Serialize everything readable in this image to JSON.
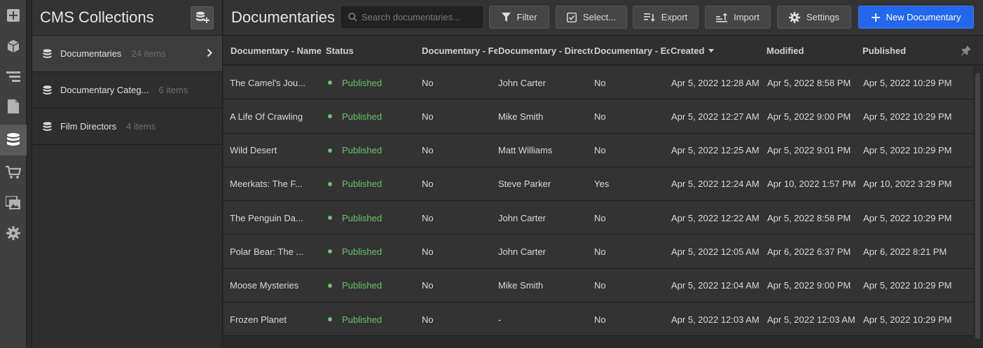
{
  "rail": {
    "items": [
      {
        "icon": "add-box-icon"
      },
      {
        "icon": "cube-icon"
      },
      {
        "icon": "navigator-icon"
      },
      {
        "icon": "pages-icon"
      },
      {
        "icon": "cms-icon",
        "active": true
      },
      {
        "icon": "ecommerce-icon"
      },
      {
        "icon": "assets-icon"
      },
      {
        "icon": "settings-icon"
      }
    ]
  },
  "panel": {
    "title": "CMS Collections",
    "collections": [
      {
        "name": "Documentaries",
        "count": "24 items",
        "active": true
      },
      {
        "name": "Documentary Categ...",
        "count": "6 items"
      },
      {
        "name": "Film Directors",
        "count": "4 items"
      }
    ]
  },
  "main": {
    "title": "Documentaries",
    "search_placeholder": "Search documentaries...",
    "buttons": {
      "filter": "Filter",
      "select": "Select...",
      "export": "Export",
      "import": "Import",
      "settings": "Settings",
      "new": "New Documentary"
    }
  },
  "table": {
    "headers": [
      "Documentary - Name",
      "Status",
      "Documentary - Featured",
      "Documentary - Director",
      "Documentary - Editor's Pick",
      "Created",
      "Modified",
      "Published"
    ],
    "rows": [
      {
        "name": "The Camel's Jou...",
        "status": "Published",
        "c3": "No",
        "director": "John Carter",
        "c5": "No",
        "created": "Apr 5, 2022 12:28 AM",
        "modified": "Apr 5, 2022 8:58 PM",
        "published": "Apr 5, 2022 10:29 PM"
      },
      {
        "name": "A Life Of Crawling",
        "status": "Published",
        "c3": "No",
        "director": "Mike Smith",
        "c5": "No",
        "created": "Apr 5, 2022 12:27 AM",
        "modified": "Apr 5, 2022 9:00 PM",
        "published": "Apr 5, 2022 10:29 PM"
      },
      {
        "name": "Wild Desert",
        "status": "Published",
        "c3": "No",
        "director": "Matt Williams",
        "c5": "No",
        "created": "Apr 5, 2022 12:25 AM",
        "modified": "Apr 5, 2022 9:01 PM",
        "published": "Apr 5, 2022 10:29 PM"
      },
      {
        "name": "Meerkats: The F...",
        "status": "Published",
        "c3": "No",
        "director": "Steve Parker",
        "c5": "Yes",
        "created": "Apr 5, 2022 12:24 AM",
        "modified": "Apr 10, 2022 1:57 PM",
        "published": "Apr 10, 2022 3:29 PM"
      },
      {
        "name": "The Penguin Da...",
        "status": "Published",
        "c3": "No",
        "director": "John Carter",
        "c5": "No",
        "created": "Apr 5, 2022 12:22 AM",
        "modified": "Apr 5, 2022 8:58 PM",
        "published": "Apr 5, 2022 10:29 PM"
      },
      {
        "name": "Polar Bear: The ...",
        "status": "Published",
        "c3": "No",
        "director": "John Carter",
        "c5": "No",
        "created": "Apr 5, 2022 12:05 AM",
        "modified": "Apr 6, 2022 6:37 PM",
        "published": "Apr 6, 2022 8:21 PM"
      },
      {
        "name": "Moose Mysteries",
        "status": "Published",
        "c3": "No",
        "director": "Mike Smith",
        "c5": "No",
        "created": "Apr 5, 2022 12:04 AM",
        "modified": "Apr 5, 2022 9:00 PM",
        "published": "Apr 5, 2022 10:29 PM"
      },
      {
        "name": "Frozen Planet",
        "status": "Published",
        "c3": "No",
        "director": "-",
        "c5": "No",
        "created": "Apr 5, 2022 12:03 AM",
        "modified": "Apr 5, 2022 12:03 AM",
        "published": "Apr 5, 2022 10:29 PM"
      }
    ]
  },
  "colors": {
    "accent": "#2467eb",
    "published": "#6ac26a"
  }
}
